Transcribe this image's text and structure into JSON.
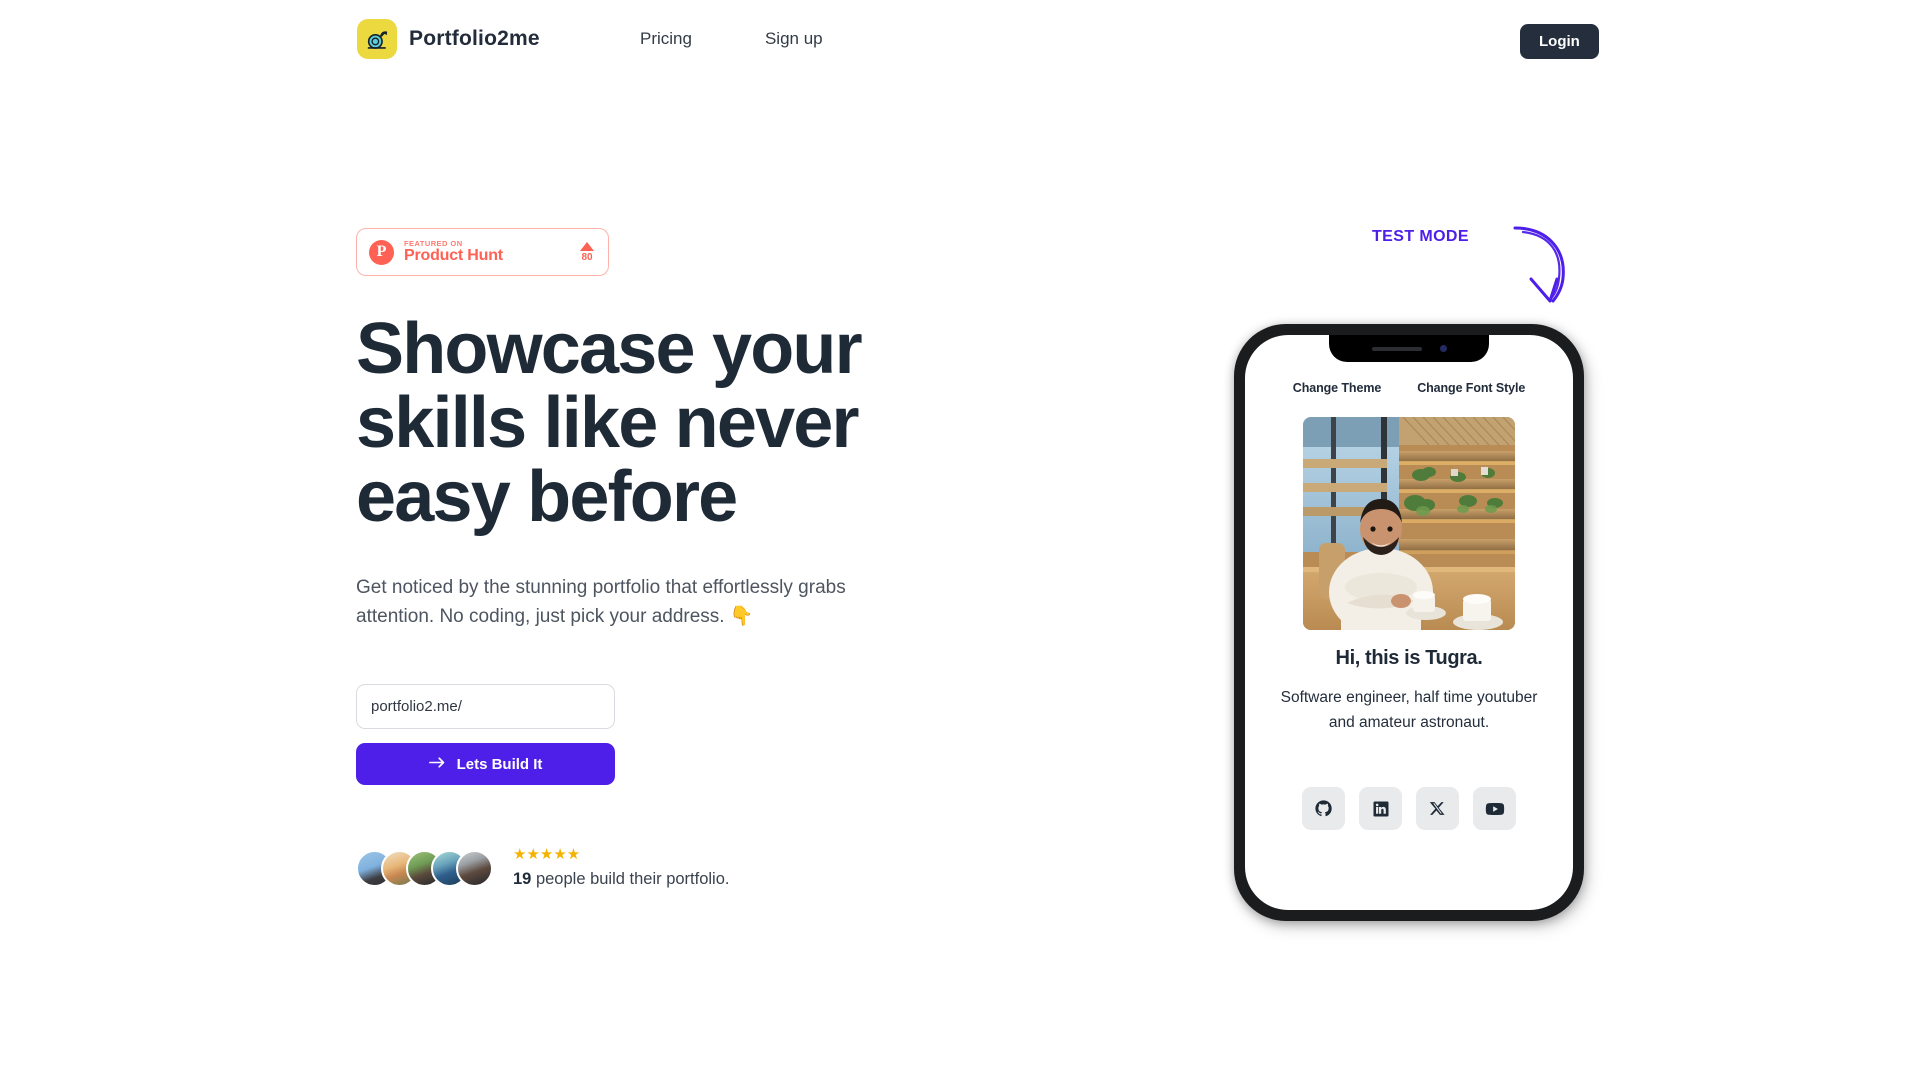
{
  "brand": {
    "name": "Portfolio2me",
    "logo_icon": "snail-icon",
    "logo_bg": "#ecd93f",
    "snail_color": "#2fb8bf"
  },
  "nav": {
    "links": [
      {
        "label": "Pricing",
        "name": "nav-link-pricing"
      },
      {
        "label": "Sign up",
        "name": "nav-link-signup"
      }
    ],
    "login_label": "Login",
    "login_bg": "#242e3d"
  },
  "badge": {
    "letter": "P",
    "eyebrow": "FEATURED ON",
    "title": "Product Hunt",
    "vote_count": "80",
    "color": "#ff6154"
  },
  "hero": {
    "headline": "Showcase your skills like never easy before",
    "subtitle": "Get noticed by the stunning portfolio that effortlessly grabs attention. No coding, just pick your address. 👇",
    "input_value": "portfolio2.me/",
    "input_placeholder": "portfolio2.me/",
    "cta_label": "Lets Build It",
    "cta_color": "#4d1fe8"
  },
  "proof": {
    "stars": "★★★★★",
    "star_color": "#f5b301",
    "count": "19",
    "text": " people build their portfolio.",
    "avatar_count": 5
  },
  "test_mode": {
    "label": "TEST MODE",
    "color": "#4d1fe8"
  },
  "phone": {
    "controls": [
      {
        "label": "Change Theme",
        "name": "change-theme-button"
      },
      {
        "label": "Change Font Style",
        "name": "change-font-style-button"
      }
    ],
    "profile_name": "Hi, this is Tugra.",
    "profile_bio": "Software engineer, half time youtuber and amateur astronaut.",
    "photo_alt": "man-in-cafe-photo",
    "socials": [
      {
        "name": "github-icon",
        "label": "GitHub"
      },
      {
        "name": "linkedin-icon",
        "label": "LinkedIn"
      },
      {
        "name": "x-twitter-icon",
        "label": "X"
      },
      {
        "name": "youtube-icon",
        "label": "YouTube"
      }
    ]
  }
}
